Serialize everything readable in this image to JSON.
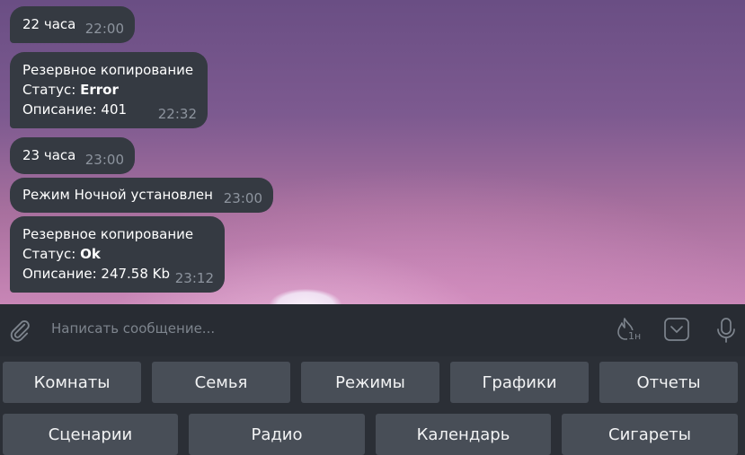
{
  "messages": [
    {
      "lines": [
        {
          "text": "22 часа"
        }
      ],
      "time": "22:00"
    },
    {
      "lines": [
        {
          "text": "Резервное копирование"
        },
        {
          "prefix": "Статус: ",
          "bold": "Error"
        },
        {
          "text": "Описание: 401"
        }
      ],
      "time": "22:32"
    },
    {
      "lines": [
        {
          "text": "23 часа"
        }
      ],
      "time": "23:00"
    },
    {
      "lines": [
        {
          "text": "Режим Ночной установлен"
        }
      ],
      "time": "23:00"
    },
    {
      "lines": [
        {
          "text": "Резервное копирование"
        },
        {
          "prefix": "Статус: ",
          "bold": "Ok"
        },
        {
          "text": "Описание: 247.58 Kb"
        }
      ],
      "time": "23:12"
    }
  ],
  "composer": {
    "placeholder": "Написать сообщение...",
    "timer_label": "1н",
    "icons": [
      "paperclip-icon",
      "self-destruct-timer-icon",
      "bot-keyboard-icon",
      "microphone-icon"
    ]
  },
  "keyboard": {
    "row1": [
      "Комнаты",
      "Семья",
      "Режимы",
      "Графики",
      "Отчеты"
    ],
    "row2": [
      "Сценарии",
      "Радио",
      "Календарь",
      "Сигареты"
    ]
  },
  "colors": {
    "bubble": "#353a42",
    "time_text": "#8d949e",
    "composer_bg": "#282c33",
    "key_button": "#484e57",
    "wallpaper_top": "#6a4e84",
    "wallpaper_bottom": "#c886b6"
  }
}
